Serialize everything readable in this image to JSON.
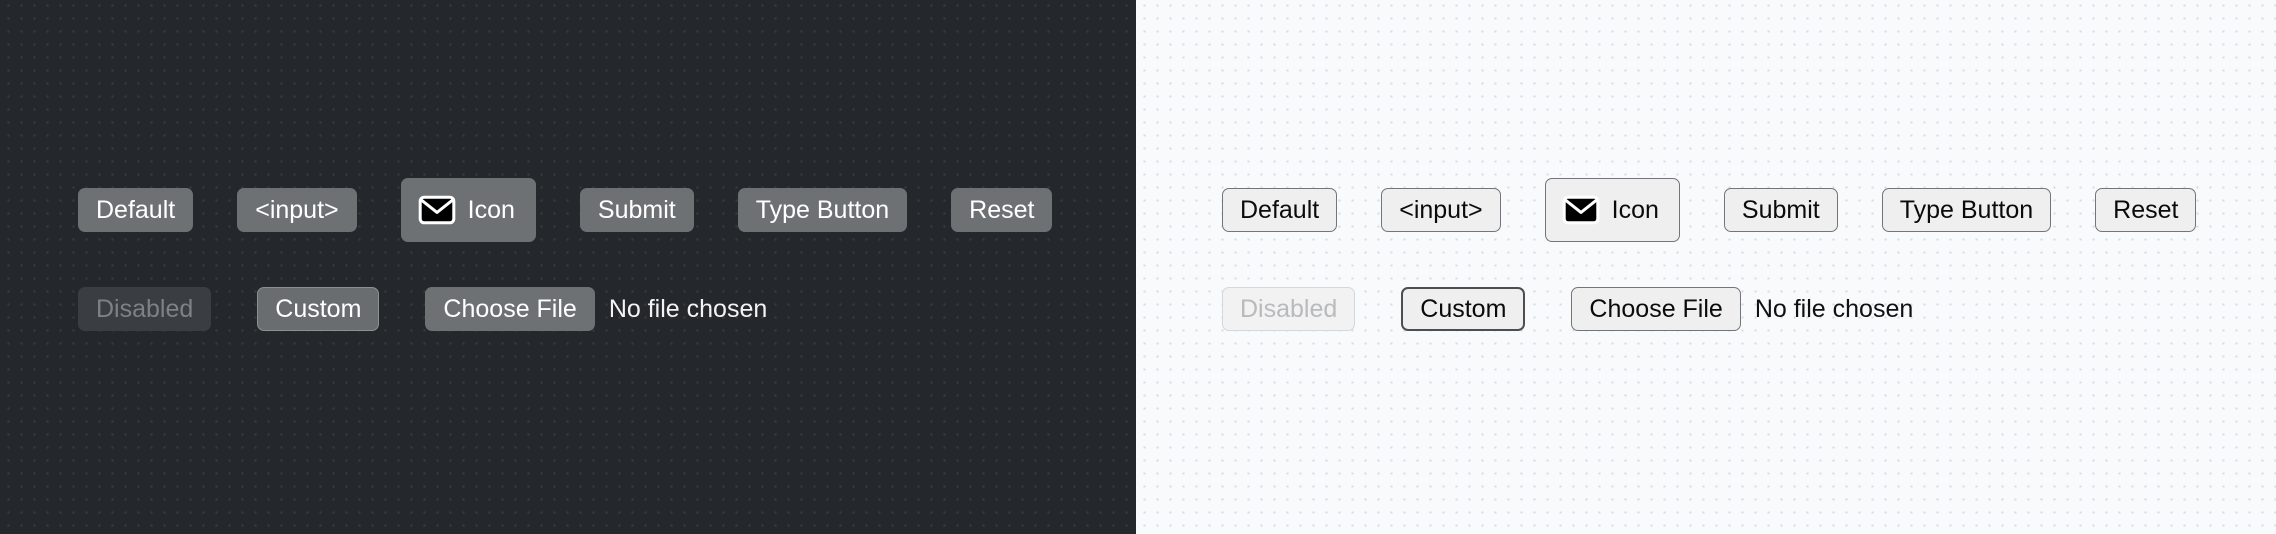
{
  "panels": {
    "dark": {
      "name": "dark-theme-panel",
      "background_color": "#24282c",
      "row1": [
        {
          "label": "Default",
          "name": "default-button"
        },
        {
          "label": "<input>",
          "name": "input-button"
        },
        {
          "label": "Icon",
          "name": "icon-button",
          "icon": "envelope-icon"
        },
        {
          "label": "Submit",
          "name": "submit-button"
        },
        {
          "label": "Type Button",
          "name": "type-button"
        },
        {
          "label": "Reset",
          "name": "reset-button"
        }
      ],
      "row2": {
        "disabled_label": "Disabled",
        "custom_label": "Custom",
        "choose_file_label": "Choose File",
        "file_status": "No file chosen"
      }
    },
    "light": {
      "name": "light-theme-panel",
      "background_color": "#f9fafb",
      "row1": [
        {
          "label": "Default",
          "name": "default-button"
        },
        {
          "label": "<input>",
          "name": "input-button"
        },
        {
          "label": "Icon",
          "name": "icon-button",
          "icon": "envelope-icon"
        },
        {
          "label": "Submit",
          "name": "submit-button"
        },
        {
          "label": "Type Button",
          "name": "type-button"
        },
        {
          "label": "Reset",
          "name": "reset-button"
        }
      ],
      "row2": {
        "disabled_label": "Disabled",
        "custom_label": "Custom",
        "choose_file_label": "Choose File",
        "file_status": "No file chosen"
      }
    }
  },
  "colors": {
    "dark_bg": "#24282c",
    "dark_button_fill": "#6e7174",
    "dark_button_text": "#ffffff",
    "dark_disabled_fill": "#3a3e42",
    "dark_disabled_text": "#7e8185",
    "light_bg": "#f9fafb",
    "light_button_fill": "#efeff0",
    "light_button_text": "#0b0b0c",
    "light_button_border": "#747578",
    "light_disabled_text": "#b9babc",
    "icon_fill": "#000000",
    "icon_stroke": "#ffffff"
  }
}
